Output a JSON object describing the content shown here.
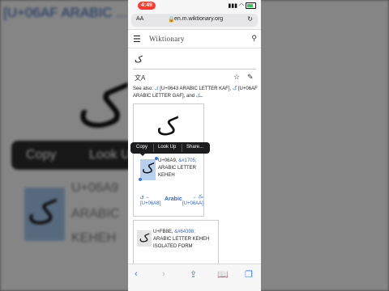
{
  "background": {
    "title": "[U+06AF ARABIC ... ک -",
    "toolbar": {
      "copy": "Copy",
      "lookup": "Look U"
    },
    "big_glyph": "ک",
    "small_glyph": "ک",
    "line1": "U+06A9",
    "line2": "ARABIC",
    "line3": "KEHEH"
  },
  "status": {
    "time": "4:49"
  },
  "browser": {
    "aa": "AA",
    "url": "en.m.wiktionary.org"
  },
  "header": {
    "title": "Wiktionary"
  },
  "page": {
    "title": "ک",
    "see_also": {
      "prefix": "See also: ",
      "link1": "ك",
      "mid1": " [U+0643 ARABIC LETTER KAF], ",
      "link2": "گ",
      "mid2": " [U+06AF ARABIC LETTER GAF], and ",
      "link3": "ـک",
      "suffix": "."
    }
  },
  "char_box": {
    "big_glyph": "ک",
    "glyph": "ک",
    "code": "U+06A9, ",
    "entity": "&#1705;",
    "name1": "ARABIC LETTER",
    "name2": "KEHEH",
    "prev_glyph": "ڨ ←",
    "prev_code": "[U+06A8]",
    "script": "Arabic",
    "next_glyph": "→ ڪ",
    "next_code": "[U+06AA]"
  },
  "context_menu": {
    "copy": "Copy",
    "lookup": "Look Up",
    "share": "Share..."
  },
  "char_box2": {
    "glyph": "ک",
    "code": "U+FB8E, ",
    "entity": "&#64398;",
    "name1": "ARABIC LETTER KEHEH",
    "name2": "ISOLATED FORM"
  },
  "icons": {
    "back": "back-icon",
    "forward": "forward-icon",
    "share": "share-icon",
    "bookmarks": "bookmarks-icon",
    "tabs": "tabs-icon"
  }
}
